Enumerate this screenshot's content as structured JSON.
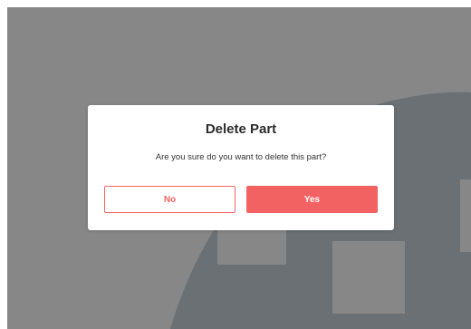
{
  "dialog": {
    "title": "Delete Part",
    "message": "Are you sure do you want to delete this part?",
    "no_label": "No",
    "yes_label": "Yes"
  },
  "colors": {
    "overlay": "#878787",
    "accent": "#f26262",
    "dialog_bg": "#ffffff"
  }
}
